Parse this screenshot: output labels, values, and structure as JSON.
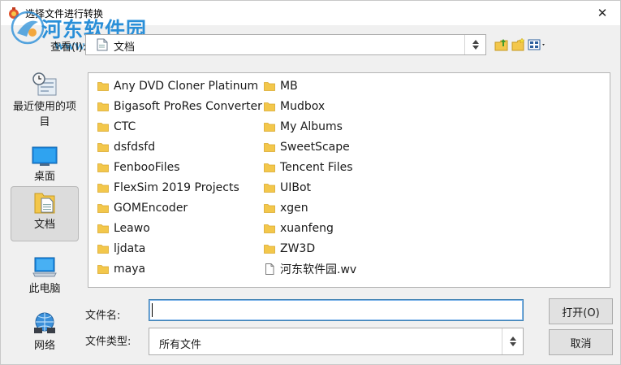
{
  "window": {
    "title": "选择文件进行转换",
    "close_glyph": "✕"
  },
  "watermark": {
    "name": "河东软件园",
    "url": "www.pc0359.cn"
  },
  "lookin": {
    "label": "查看(I):",
    "value": "文档",
    "icon": "documents-folder-icon"
  },
  "toolbar": [
    {
      "name": "up-folder-icon"
    },
    {
      "name": "new-folder-icon"
    },
    {
      "name": "view-menu-icon"
    }
  ],
  "places": [
    {
      "label": "最近使用的项目",
      "icon": "recent-items-icon",
      "selected": false
    },
    {
      "label": "桌面",
      "icon": "desktop-icon",
      "selected": false
    },
    {
      "label": "文档",
      "icon": "documents-icon",
      "selected": true
    },
    {
      "label": "此电脑",
      "icon": "computer-icon",
      "selected": false
    },
    {
      "label": "网络",
      "icon": "network-icon",
      "selected": false
    }
  ],
  "files": {
    "column1": [
      "Any DVD Cloner Platinum",
      "Bigasoft ProRes Converter",
      "CTC",
      "dsfdsfd",
      "FenbooFiles",
      "FlexSim 2019 Projects",
      "GOMEncoder",
      "Leawo",
      "ljdata",
      "maya"
    ],
    "column2": [
      "MB",
      "Mudbox",
      "My Albums",
      "SweetScape",
      "Tencent Files",
      "UIBot",
      "xgen",
      "xuanfeng",
      "ZW3D",
      "河东软件园.wv"
    ]
  },
  "filename": {
    "label": "文件名:",
    "value": ""
  },
  "filetype": {
    "label": "文件类型:",
    "value": "所有文件"
  },
  "buttons": {
    "open": "打开(O)",
    "cancel": "取消"
  },
  "colors": {
    "folder": "#f3c74b",
    "accent": "#2a8fd8",
    "selected_place": "#dcdcdc"
  }
}
